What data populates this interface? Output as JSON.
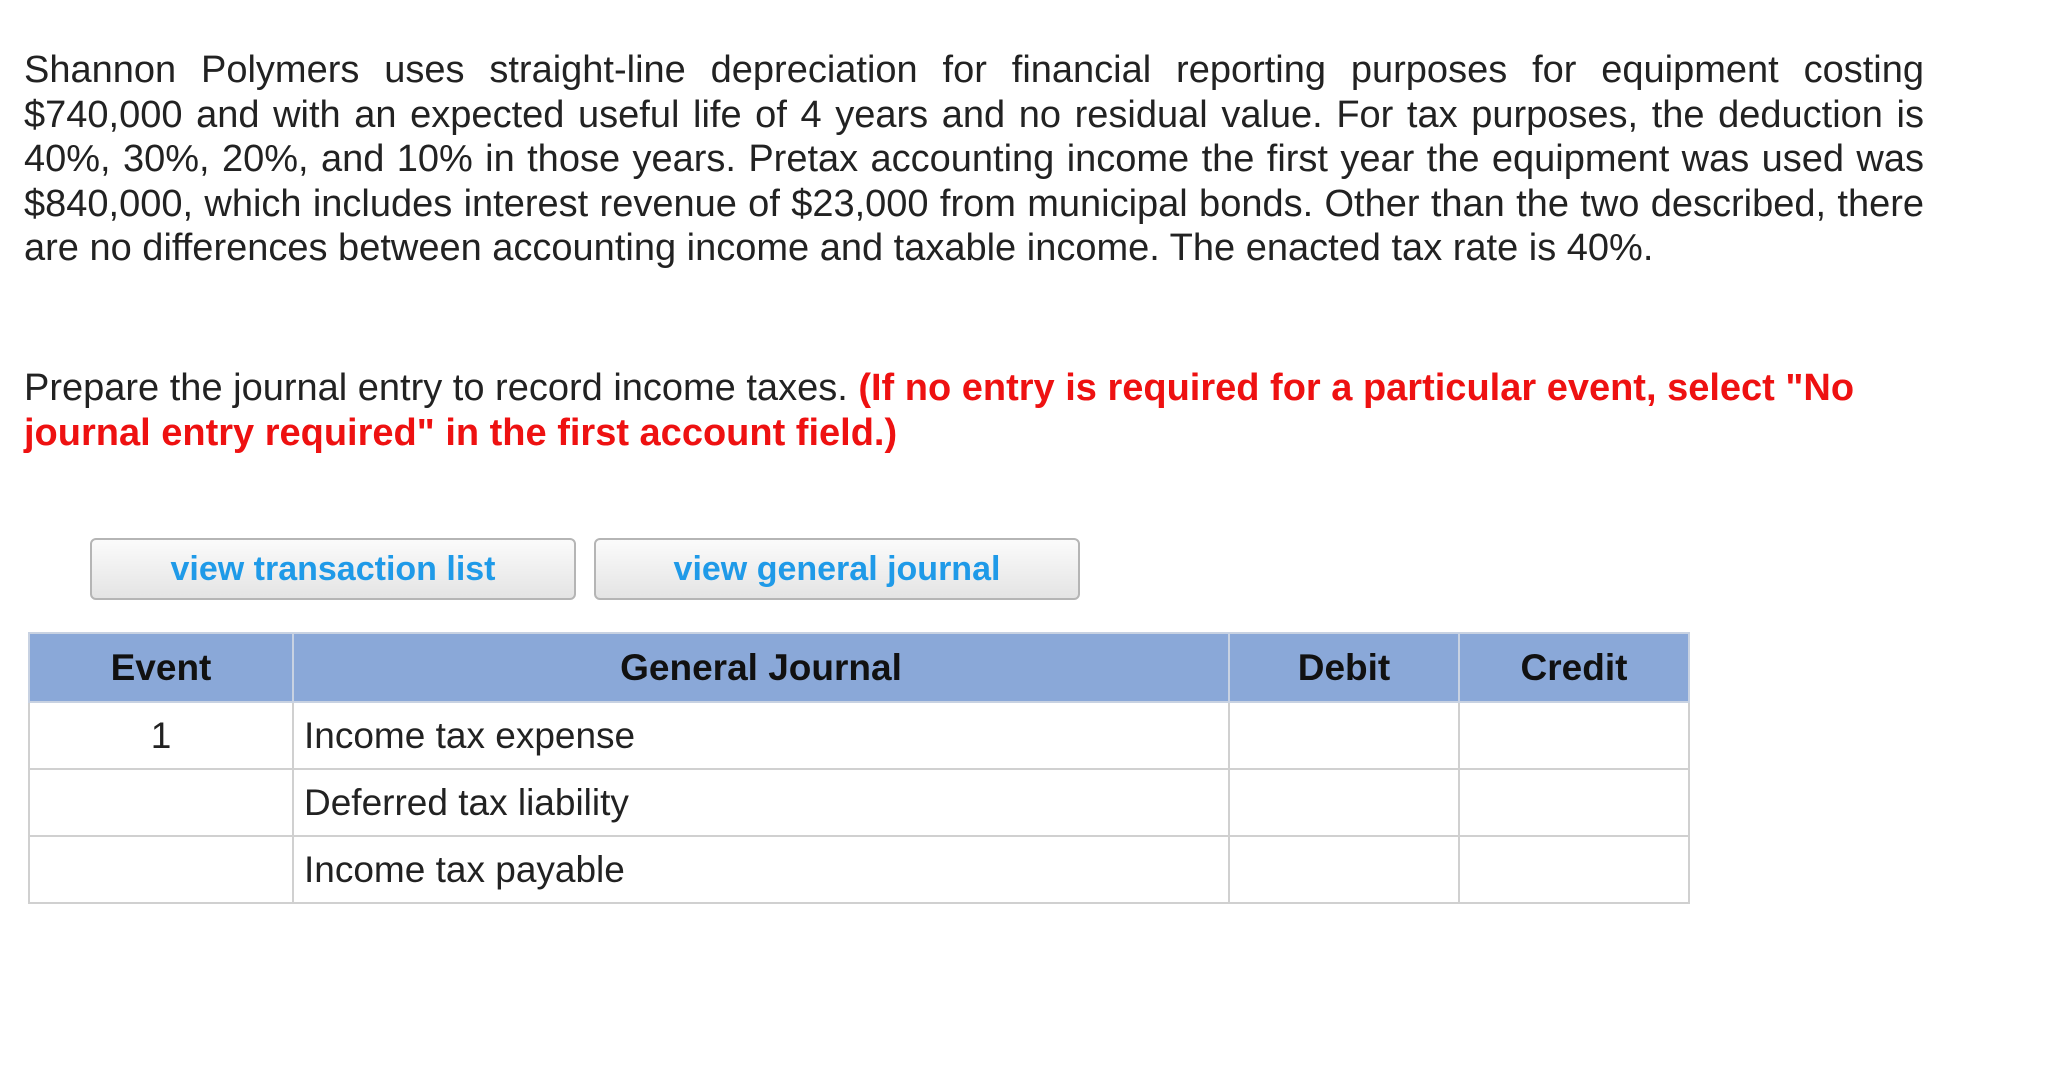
{
  "problem": {
    "text": "Shannon Polymers uses straight-line depreciation for financial reporting purposes for equipment costing $740,000 and with an expected useful life of 4 years and no residual value. For tax purposes, the deduction is 40%, 30%, 20%, and 10% in those years. Pretax accounting income the first year the equipment was used was $840,000, which includes interest revenue of $23,000 from municipal bonds. Other than the two described, there are no differences between accounting income and taxable income. The enacted tax rate is 40%."
  },
  "instruction": {
    "text": "Prepare the journal entry to record income taxes.",
    "warning": "(If no entry is required for a particular event, select \"No journal entry required\" in the first account field.)"
  },
  "buttons": {
    "transaction_list": "view transaction list",
    "general_journal": "view general journal"
  },
  "table": {
    "headers": [
      "Event",
      "General Journal",
      "Debit",
      "Credit"
    ],
    "rows": [
      {
        "event": "1",
        "account": "Income tax expense",
        "debit": "",
        "credit": ""
      },
      {
        "event": "",
        "account": "Deferred tax liability",
        "debit": "",
        "credit": ""
      },
      {
        "event": "",
        "account": "Income tax payable",
        "debit": "",
        "credit": ""
      }
    ]
  },
  "colors": {
    "header_bg": "#8aa8d8",
    "warning": "#ee1111",
    "button_text": "#1f9ae8"
  }
}
